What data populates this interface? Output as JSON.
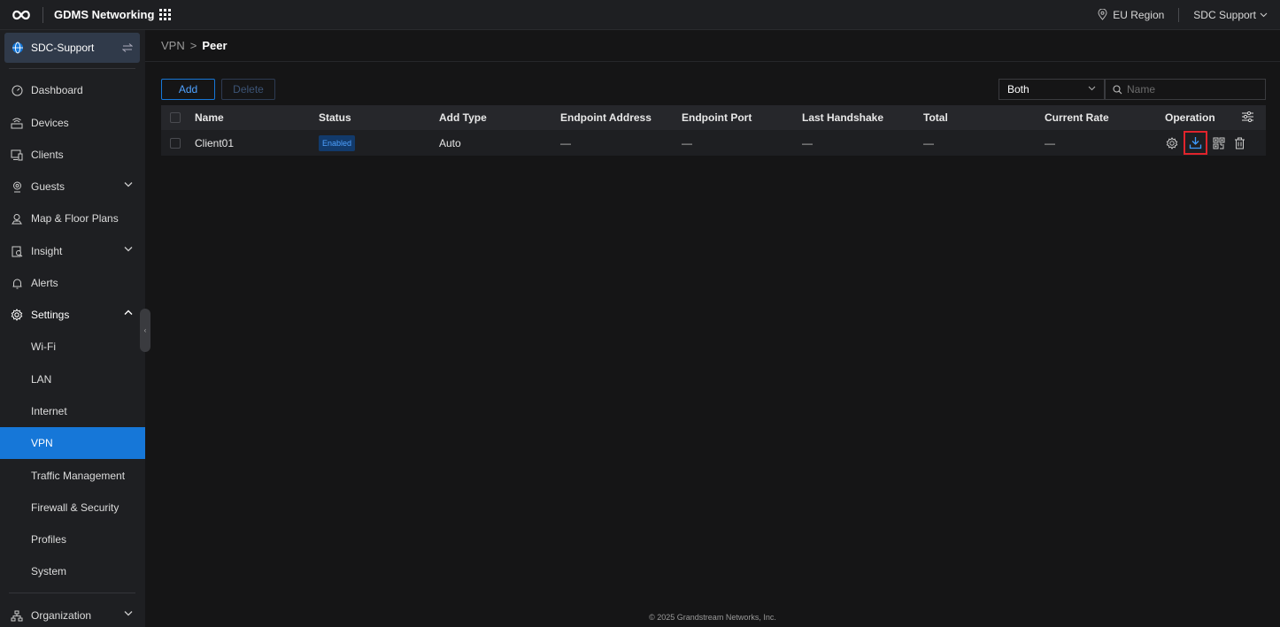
{
  "topbar": {
    "app_title": "GDMS Networking",
    "region": "EU Region",
    "user": "SDC Support"
  },
  "sidebar": {
    "site": "SDC-Support",
    "items": [
      {
        "label": "Dashboard",
        "icon": "dashboard-icon"
      },
      {
        "label": "Devices",
        "icon": "devices-icon"
      },
      {
        "label": "Clients",
        "icon": "clients-icon"
      },
      {
        "label": "Guests",
        "icon": "guests-icon",
        "expandable": true
      },
      {
        "label": "Map & Floor Plans",
        "icon": "map-icon"
      },
      {
        "label": "Insight",
        "icon": "insight-icon",
        "expandable": true
      },
      {
        "label": "Alerts",
        "icon": "bell-icon"
      },
      {
        "label": "Settings",
        "icon": "gear-icon",
        "expanded": true
      }
    ],
    "settings_subitems": [
      "Wi-Fi",
      "LAN",
      "Internet",
      "VPN",
      "Traffic Management",
      "Firewall & Security",
      "Profiles",
      "System"
    ],
    "active_subitem": "VPN",
    "organization": "Organization"
  },
  "breadcrumb": {
    "parent": "VPN",
    "separator": ">",
    "current": "Peer"
  },
  "toolbar": {
    "add_label": "Add",
    "delete_label": "Delete",
    "filter_value": "Both",
    "search_placeholder": "Name"
  },
  "table": {
    "columns": [
      "Name",
      "Status",
      "Add Type",
      "Endpoint Address",
      "Endpoint Port",
      "Last Handshake",
      "Total",
      "Current Rate",
      "Operation"
    ],
    "rows": [
      {
        "name": "Client01",
        "status": "Enabled",
        "add_type": "Auto",
        "endpoint_address": "—",
        "endpoint_port": "—",
        "last_handshake": "—",
        "total": "—",
        "current_rate": "—",
        "operations": [
          "gear-icon",
          "download-icon",
          "qr-code-icon",
          "trash-icon"
        ]
      }
    ]
  },
  "footer": "© 2025 Grandstream Networks, Inc.",
  "colors": {
    "accent": "#1677d8",
    "highlight_box": "#e0242c",
    "background": "#151516",
    "sidebar": "#1e1f22"
  }
}
